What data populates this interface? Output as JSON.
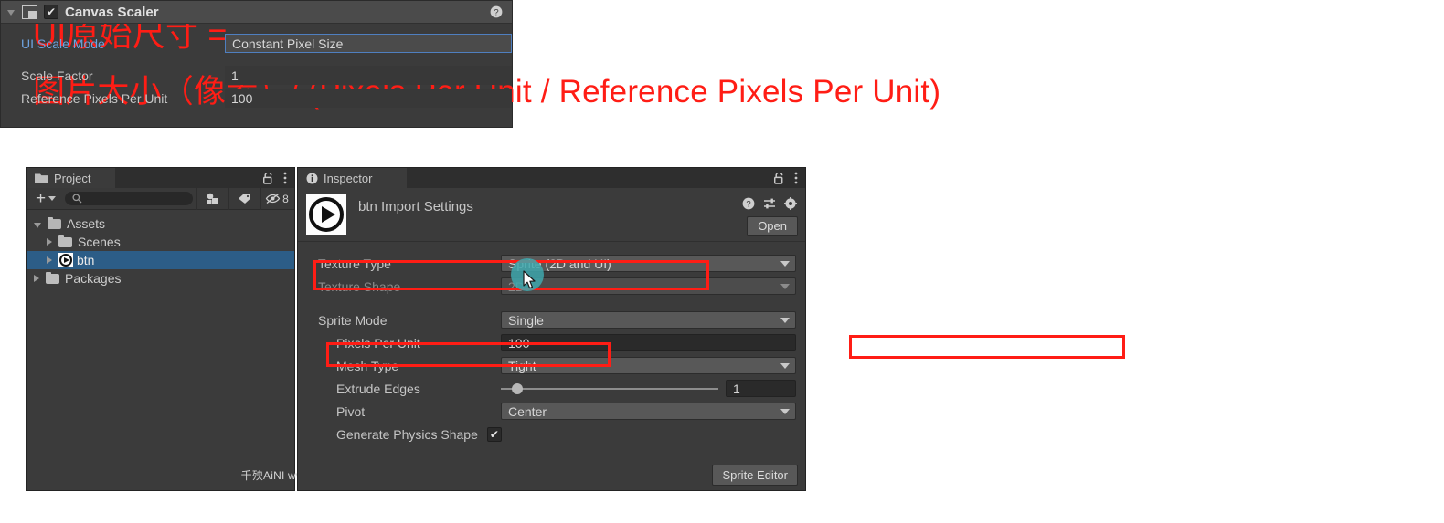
{
  "heading": {
    "line1": "UI原始尺寸 =",
    "line2": "图片大小（像素）/ (Pixels Per Unit / Reference Pixels Per Unit)",
    "color": "#ff1d15"
  },
  "project_panel": {
    "tab_label": "Project",
    "lock_icon": "lock-icon",
    "menu_icon": "kebab-menu-icon",
    "toolbar": {
      "create_label": "+",
      "search_value": "",
      "search_placeholder": "",
      "hidden_count": "8"
    },
    "tree": [
      {
        "label": "Assets",
        "depth": 0,
        "expanded": true,
        "icon": "folder-icon",
        "selected": false
      },
      {
        "label": "Scenes",
        "depth": 1,
        "expanded": false,
        "icon": "folder-icon",
        "selected": false
      },
      {
        "label": "btn",
        "depth": 1,
        "expanded": false,
        "icon": "sprite-icon",
        "selected": true
      },
      {
        "label": "Packages",
        "depth": 0,
        "expanded": false,
        "icon": "folder-icon",
        "selected": false
      }
    ],
    "watermark": "千殃AiNI www.taikr.com",
    "selection_color": "#2c5d87"
  },
  "inspector_panel": {
    "tab_label": "Inspector",
    "title": "btn Import Settings",
    "thumb_icon": "sprite-play-icon",
    "help_icon": "help-icon",
    "preset_icon": "preset-sliders-icon",
    "settings_icon": "gear-icon",
    "open_label": "Open",
    "sprite_editor_label": "Sprite Editor",
    "rows": [
      {
        "label": "Texture Type",
        "value": "Sprite (2D and UI)",
        "control": "popup",
        "indent": 0,
        "disabled": false,
        "highlighted": true
      },
      {
        "label": "Texture Shape",
        "value": "2D",
        "control": "popup",
        "indent": 0,
        "disabled": true,
        "highlighted": false
      },
      {
        "label": "Sprite Mode",
        "value": "Single",
        "control": "popup",
        "indent": 0,
        "disabled": false,
        "highlighted": false
      },
      {
        "label": "Pixels Per Unit",
        "value": "100",
        "control": "number",
        "indent": 1,
        "disabled": false,
        "highlighted": true
      },
      {
        "label": "Mesh Type",
        "value": "Tight",
        "control": "popup",
        "indent": 1,
        "disabled": false,
        "highlighted": false
      },
      {
        "label": "Extrude Edges",
        "value": "1",
        "control": "slider",
        "indent": 1,
        "disabled": false,
        "highlighted": false
      },
      {
        "label": "Pivot",
        "value": "Center",
        "control": "popup",
        "indent": 1,
        "disabled": false,
        "highlighted": false
      },
      {
        "label": "Generate Physics Shape",
        "value": "checked",
        "control": "checkbox",
        "indent": 1,
        "disabled": false,
        "highlighted": false
      }
    ],
    "slider_percent": 5
  },
  "canvas_scaler_panel": {
    "title": "Canvas Scaler",
    "enabled": true,
    "component_icon": "canvas-scaler-icon",
    "help_icon": "help-icon",
    "rows": [
      {
        "label": "UI Scale Mode",
        "value": "Constant Pixel Size",
        "control": "popup",
        "accent": true,
        "highlighted": false
      },
      {
        "label": "Scale Factor",
        "value": "1",
        "control": "number",
        "accent": false,
        "highlighted": false
      },
      {
        "label": "Reference Pixels Per Unit",
        "value": "100",
        "control": "number",
        "accent": false,
        "highlighted": true
      }
    ],
    "accent_color": "#6ea3e0"
  },
  "annotations": {
    "redbox_color": "#ff1d15",
    "cursor": {
      "halo_color": "#3fa8ae"
    }
  }
}
